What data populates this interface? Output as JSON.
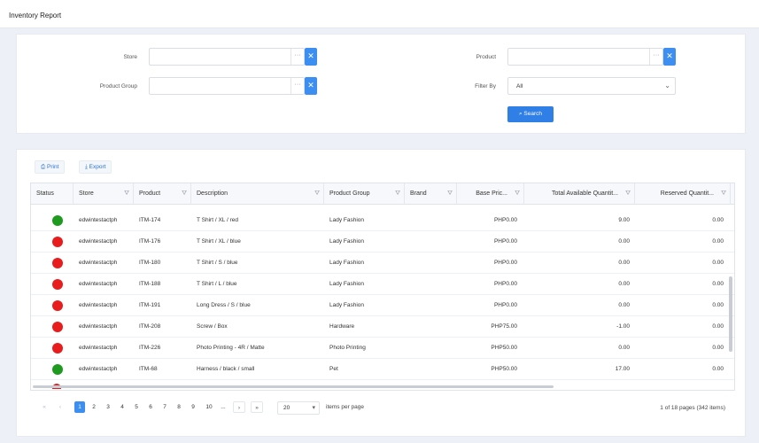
{
  "app": {
    "title": "Inventory Report"
  },
  "filters": {
    "store_label": "Store",
    "product_label": "Product",
    "product_group_label": "Product Group",
    "filter_by_label": "Filter By",
    "store_value": "",
    "product_value": "",
    "product_group_value": "",
    "filter_by_value": "All",
    "dots": "···",
    "clear_glyph": "✕",
    "search_label": "⌕ Search"
  },
  "toolbar": {
    "print_label": "⎙ Print",
    "export_label": "⤓ Export"
  },
  "table": {
    "headers": [
      "Status",
      "Store",
      "Product",
      "Description",
      "Product Group",
      "Brand",
      "Base Pric...",
      "Total Available Quantit...",
      "Reserved Quantit..."
    ],
    "filter_icon": "⛛",
    "rows": [
      {
        "status": "green",
        "store": "edwintestactph",
        "product": "ITM-174",
        "description": "T Shirt / XL / red",
        "group": "Lady Fashion",
        "brand": "",
        "price": "PHP0.00",
        "available": "9.00",
        "reserved": "0.00"
      },
      {
        "status": "red",
        "store": "edwintestactph",
        "product": "ITM-176",
        "description": "T Shirt / XL / blue",
        "group": "Lady Fashion",
        "brand": "",
        "price": "PHP0.00",
        "available": "0.00",
        "reserved": "0.00"
      },
      {
        "status": "red",
        "store": "edwintestactph",
        "product": "ITM-180",
        "description": "T Shirt / S / blue",
        "group": "Lady Fashion",
        "brand": "",
        "price": "PHP0.00",
        "available": "0.00",
        "reserved": "0.00"
      },
      {
        "status": "red",
        "store": "edwintestactph",
        "product": "ITM-188",
        "description": "T Shirt / L / blue",
        "group": "Lady Fashion",
        "brand": "",
        "price": "PHP0.00",
        "available": "0.00",
        "reserved": "0.00"
      },
      {
        "status": "red",
        "store": "edwintestactph",
        "product": "ITM-191",
        "description": "Long Dress / S / blue",
        "group": "Lady Fashion",
        "brand": "",
        "price": "PHP0.00",
        "available": "0.00",
        "reserved": "0.00"
      },
      {
        "status": "red",
        "store": "edwintestactph",
        "product": "ITM-208",
        "description": "Screw / Box",
        "group": "Hardware",
        "brand": "",
        "price": "PHP75.00",
        "available": "-1.00",
        "reserved": "0.00"
      },
      {
        "status": "red",
        "store": "edwintestactph",
        "product": "ITM-226",
        "description": "Photo Printing - 4R / Matte",
        "group": "Photo Printing",
        "brand": "",
        "price": "PHP50.00",
        "available": "0.00",
        "reserved": "0.00"
      },
      {
        "status": "green",
        "store": "edwintestactph",
        "product": "ITM-68",
        "description": "Harness / black / small",
        "group": "Pet",
        "brand": "",
        "price": "PHP50.00",
        "available": "17.00",
        "reserved": "0.00"
      }
    ]
  },
  "pagination": {
    "first": "«",
    "prev": "‹",
    "pages": [
      "1",
      "2",
      "3",
      "4",
      "5",
      "6",
      "7",
      "8",
      "9",
      "10",
      "..."
    ],
    "next": "›",
    "last": "»",
    "page_size": "20",
    "page_size_arrow": "▾",
    "items_per_page_label": "items per page",
    "info": "1 of 18 pages (342 items)"
  },
  "colors": {
    "accent": "#3c8ef0",
    "status_green": "#1e9a1e",
    "status_red": "#e81c1c"
  }
}
